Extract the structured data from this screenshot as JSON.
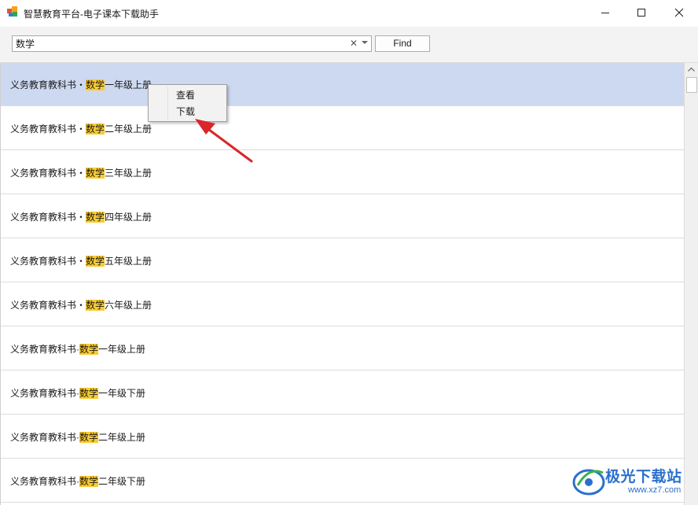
{
  "window": {
    "title": "智慧教育平台-电子课本下载助手",
    "icon": "app-logo-icon",
    "controls": [
      "minimize-icon",
      "maximize-icon",
      "close-icon"
    ]
  },
  "search": {
    "value": "数学",
    "placeholder": "",
    "find_label": "Find"
  },
  "list": {
    "rows": [
      {
        "prefix": "义务教育教科书・",
        "highlight": "数学",
        "suffix": "一年级上册",
        "selected": true
      },
      {
        "prefix": "义务教育教科书・",
        "highlight": "数学",
        "suffix": "二年级上册",
        "selected": false
      },
      {
        "prefix": "义务教育教科书・",
        "highlight": "数学",
        "suffix": "三年级上册",
        "selected": false
      },
      {
        "prefix": "义务教育教科书・",
        "highlight": "数学",
        "suffix": "四年级上册",
        "selected": false
      },
      {
        "prefix": "义务教育教科书・",
        "highlight": "数学",
        "suffix": "五年级上册",
        "selected": false
      },
      {
        "prefix": "义务教育教科书・",
        "highlight": "数学",
        "suffix": "六年级上册",
        "selected": false
      },
      {
        "prefix": "义务教育教科书·",
        "highlight": "数学",
        "suffix": "一年级上册",
        "selected": false
      },
      {
        "prefix": "义务教育教科书·",
        "highlight": "数学",
        "suffix": "一年级下册",
        "selected": false
      },
      {
        "prefix": "义务教育教科书·",
        "highlight": "数学",
        "suffix": "二年级上册",
        "selected": false
      },
      {
        "prefix": "义务教育教科书·",
        "highlight": "数学",
        "suffix": "二年级下册",
        "selected": false
      }
    ]
  },
  "context_menu": {
    "items": [
      {
        "label": "查看"
      },
      {
        "label": "下载"
      }
    ]
  },
  "watermark": {
    "title": "极光下载站",
    "url": "www.xz7.com"
  },
  "colors": {
    "selected_row": "#cdd9f1",
    "highlight": "#fbcb2d",
    "annotation_arrow": "#d9262b",
    "watermark": "#2b6fce"
  }
}
